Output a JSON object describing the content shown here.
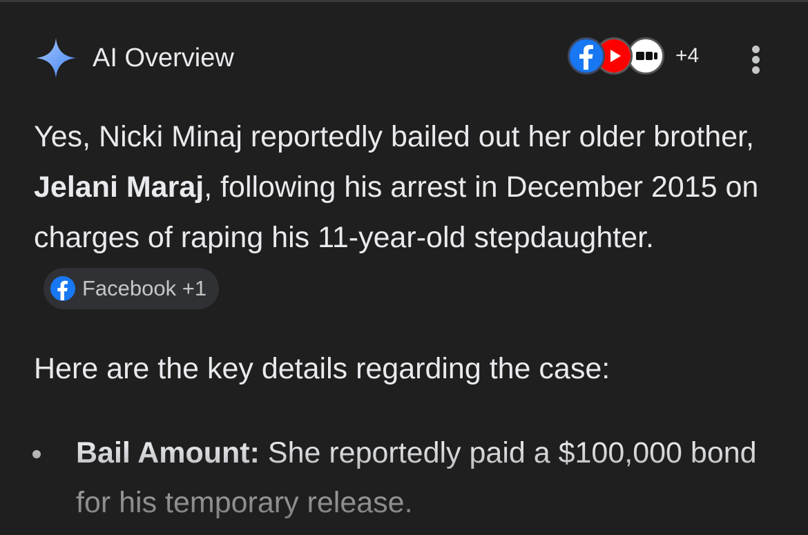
{
  "header": {
    "title": "AI Overview",
    "sources_extra": "+4",
    "source_icons": [
      "facebook-icon",
      "youtube-icon",
      "medium-icon"
    ],
    "accent": "#8ab4f8"
  },
  "paragraph1": {
    "before": "Yes, Nicki Minaj reportedly bailed out her older brother, ",
    "bold": "Jelani Maraj",
    "after": ", following his arrest in December 2015 on charges of raping his 11-year-old stepdaughter.",
    "chip_label": "Facebook +1"
  },
  "paragraph2": "Here are the key details regarding the case:",
  "bullets": [
    {
      "label": "Bail Amount:",
      "text": " She reportedly paid a $100,000 bond for his temporary release."
    }
  ],
  "colors": {
    "background": "#1f1f1f",
    "text": "#e8eaed",
    "chip_bg": "#303134",
    "facebook": "#1877f2",
    "youtube": "#ff0000"
  }
}
